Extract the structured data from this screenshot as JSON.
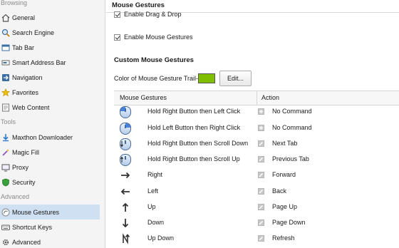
{
  "sidebar": {
    "sections": [
      "Browsing",
      "Tools",
      "Advanced"
    ],
    "items": [
      {
        "label": "General",
        "icon": "house-icon"
      },
      {
        "label": "Search Engine",
        "icon": "magnifier-icon"
      },
      {
        "label": "Tab Bar",
        "icon": "tab-bar-icon"
      },
      {
        "label": "Smart Address Bar",
        "icon": "address-bar-icon"
      },
      {
        "label": "Navigation",
        "icon": "navigation-icon"
      },
      {
        "label": "Favorites",
        "icon": "star-icon"
      },
      {
        "label": "Web Content",
        "icon": "web-content-icon"
      },
      {
        "label": "Maxthon Downloader",
        "icon": "download-icon"
      },
      {
        "label": "Magic Fill",
        "icon": "magic-wand-icon"
      },
      {
        "label": "Proxy",
        "icon": "proxy-icon"
      },
      {
        "label": "Security",
        "icon": "shield-icon"
      },
      {
        "label": "Mouse Gestures",
        "icon": "mouse-icon",
        "selected": true
      },
      {
        "label": "Shortcut Keys",
        "icon": "keyboard-icon"
      },
      {
        "label": "Advanced",
        "icon": "gear-icon"
      }
    ]
  },
  "main": {
    "title": "Mouse Gestures",
    "enable_drag_drop": "Enable Drag & Drop",
    "enable_mouse_gestures": "Enable Mouse Gestures",
    "custom_heading": "Custom Mouse Gestures",
    "trail_label": "Color of Mouse Gesture Trail-",
    "trail_color": "#7fbf00",
    "edit_button": "Edit...",
    "table": {
      "headers": [
        "Mouse Gestures",
        "Action"
      ],
      "rows": [
        {
          "icon": "mouse-left-icon",
          "gesture": "Hold Right Button then Left Click",
          "action": "No Command",
          "action_icon": "plus-icon"
        },
        {
          "icon": "mouse-right-icon",
          "gesture": "Hold Left Button then Right Click",
          "action": "No Command",
          "action_icon": "plus-icon"
        },
        {
          "icon": "mouse-scroll-down-icon",
          "gesture": "Hold Right Button then Scroll Down",
          "action": "Next Tab",
          "action_icon": "edit-icon"
        },
        {
          "icon": "mouse-scroll-up-icon",
          "gesture": "Hold Right Button then Scroll Up",
          "action": "Previous Tab",
          "action_icon": "edit-icon"
        },
        {
          "icon": "arrow-right-icon",
          "gesture": "Right",
          "action": "Forward",
          "action_icon": "edit-icon"
        },
        {
          "icon": "arrow-left-icon",
          "gesture": "Left",
          "action": "Back",
          "action_icon": "edit-icon"
        },
        {
          "icon": "arrow-up-icon",
          "gesture": "Up",
          "action": "Page Up",
          "action_icon": "edit-icon"
        },
        {
          "icon": "arrow-down-icon",
          "gesture": "Down",
          "action": "Page Down",
          "action_icon": "edit-icon"
        },
        {
          "icon": "arrow-up-down-icon",
          "gesture": "Up Down",
          "action": "Refresh",
          "action_icon": "edit-icon"
        }
      ]
    }
  }
}
